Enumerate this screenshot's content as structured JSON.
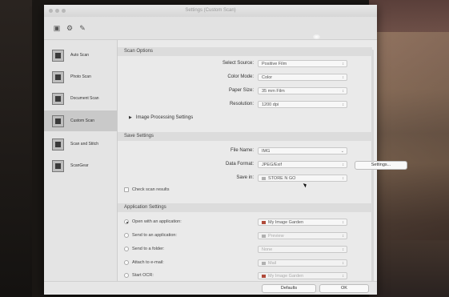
{
  "window": {
    "title": "Settings (Custom Scan)"
  },
  "toolbar": {
    "icons": [
      "scan-settings-icon",
      "general-settings-icon",
      "tools-icon"
    ]
  },
  "sidebar": {
    "items": [
      {
        "label": "Auto Scan",
        "icon": "auto-scan-icon",
        "active": false
      },
      {
        "label": "Photo Scan",
        "icon": "photo-scan-icon",
        "active": false
      },
      {
        "label": "Document Scan",
        "icon": "document-scan-icon",
        "active": false
      },
      {
        "label": "Custom Scan",
        "icon": "custom-scan-icon",
        "active": true
      },
      {
        "label": "Scan and Stitch",
        "icon": "scan-stitch-icon",
        "active": false
      },
      {
        "label": "ScanGear",
        "icon": "scangear-icon",
        "active": false
      }
    ]
  },
  "scan_options": {
    "header": "Scan Options",
    "select_source_label": "Select Source:",
    "select_source_value": "Positive Film",
    "color_mode_label": "Color Mode:",
    "color_mode_value": "Color",
    "paper_size_label": "Paper Size:",
    "paper_size_value": "35 mm Film",
    "resolution_label": "Resolution:",
    "resolution_value": "1200 dpi",
    "image_processing_label": "Image Processing Settings"
  },
  "save_settings": {
    "header": "Save Settings",
    "file_name_label": "File Name:",
    "file_name_value": "IMG",
    "data_format_label": "Data Format:",
    "data_format_value": "JPEG/Exif",
    "settings_button": "Settings...",
    "save_in_label": "Save in:",
    "save_in_value": "STORE N GO",
    "check_results_label": "Check scan results"
  },
  "app_settings": {
    "header": "Application Settings",
    "options": [
      {
        "label": "Open with an application:",
        "value": "My Image Garden",
        "selected": true,
        "disabled": false
      },
      {
        "label": "Send to an application:",
        "value": "Preview",
        "selected": false,
        "disabled": true
      },
      {
        "label": "Send to a folder:",
        "value": "None",
        "selected": false,
        "disabled": true
      },
      {
        "label": "Attach to e-mail:",
        "value": "Mail",
        "selected": false,
        "disabled": true
      },
      {
        "label": "Start OCR:",
        "value": "My Image Garden",
        "selected": false,
        "disabled": true
      }
    ]
  },
  "footer": {
    "defaults_button": "Defaults",
    "ok_button": "OK"
  }
}
